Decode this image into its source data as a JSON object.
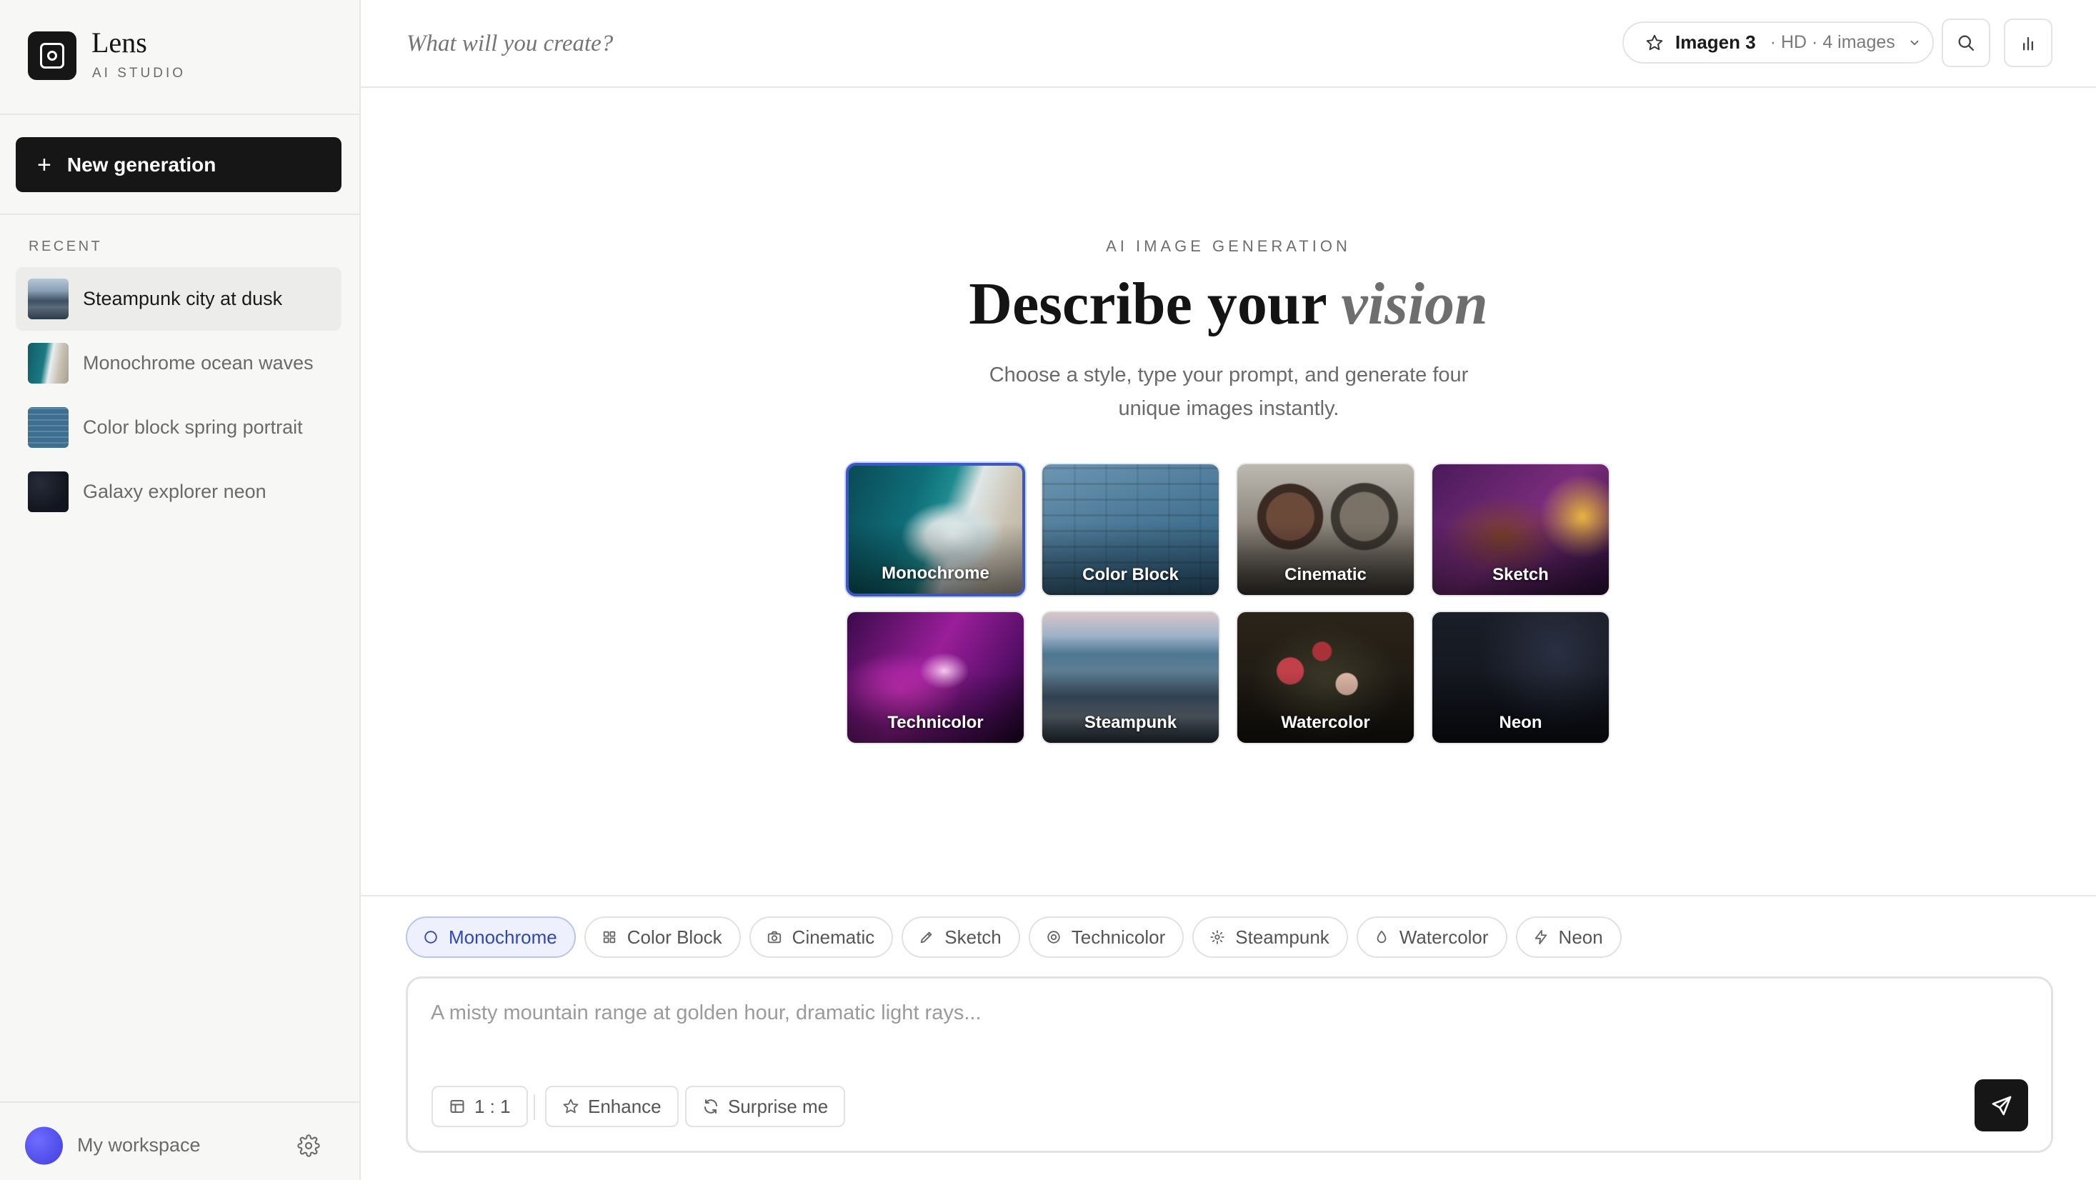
{
  "brand": {
    "name": "Lens",
    "subtitle": "AI STUDIO"
  },
  "sidebar": {
    "new_generation_label": "New generation",
    "recent_heading": "RECENT",
    "recent_items": [
      {
        "label": "Steampunk city at dusk",
        "active": true,
        "thumb": "city"
      },
      {
        "label": "Monochrome ocean waves",
        "active": false,
        "thumb": "ocean"
      },
      {
        "label": "Color block spring portrait",
        "active": false,
        "thumb": "bricks"
      },
      {
        "label": "Galaxy explorer neon",
        "active": false,
        "thumb": "night"
      }
    ],
    "workspace_label": "My workspace"
  },
  "header": {
    "prompt_placeholder": "What will you create?",
    "model_name": "Imagen 3",
    "model_meta": "· HD · 4 images"
  },
  "hero": {
    "eyebrow": "AI IMAGE GENERATION",
    "title_main": "Describe your ",
    "title_emphasis": "vision",
    "description": "Choose a style, type your prompt, and generate four unique images instantly."
  },
  "styles": [
    {
      "label": "Monochrome",
      "selected": true
    },
    {
      "label": "Color Block",
      "selected": false
    },
    {
      "label": "Cinematic",
      "selected": false
    },
    {
      "label": "Sketch",
      "selected": false
    },
    {
      "label": "Technicolor",
      "selected": false
    },
    {
      "label": "Steampunk",
      "selected": false
    },
    {
      "label": "Watercolor",
      "selected": false
    },
    {
      "label": "Neon",
      "selected": false
    }
  ],
  "chips": [
    {
      "label": "Monochrome",
      "icon": "circle-icon",
      "active": true
    },
    {
      "label": "Color Block",
      "icon": "grid-icon",
      "active": false
    },
    {
      "label": "Cinematic",
      "icon": "camera-icon",
      "active": false
    },
    {
      "label": "Sketch",
      "icon": "pencil-icon",
      "active": false
    },
    {
      "label": "Technicolor",
      "icon": "target-icon",
      "active": false
    },
    {
      "label": "Steampunk",
      "icon": "gear-icon",
      "active": false
    },
    {
      "label": "Watercolor",
      "icon": "drop-icon",
      "active": false
    },
    {
      "label": "Neon",
      "icon": "bolt-icon",
      "active": false
    }
  ],
  "composer": {
    "placeholder": "A misty mountain range at golden hour, dramatic light rays...",
    "aspect_label": "1 : 1",
    "enhance_label": "Enhance",
    "surprise_label": "Surprise me"
  },
  "colors": {
    "accent": "#3d56c7",
    "accent_bg": "#eef1fd",
    "dark": "#161616",
    "avatar": "#4f4cf0"
  }
}
